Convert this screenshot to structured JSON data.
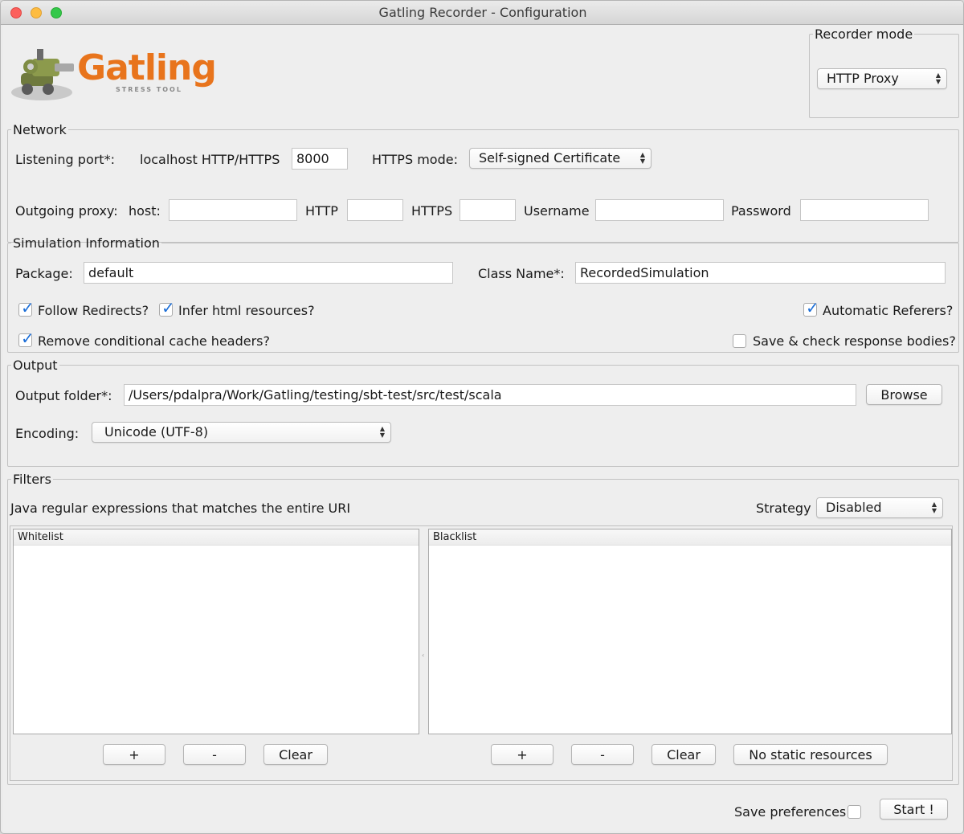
{
  "window": {
    "title": "Gatling Recorder - Configuration"
  },
  "logo": {
    "brand": "Gatling",
    "tagline": "STRESS TOOL"
  },
  "recorder_mode": {
    "legend": "Recorder mode",
    "value": "HTTP Proxy"
  },
  "network": {
    "legend": "Network",
    "listening_port_label": "Listening port*:",
    "localhost_label": "localhost HTTP/HTTPS",
    "port_value": "8000",
    "https_mode_label": "HTTPS mode:",
    "https_mode_value": "Self-signed Certificate",
    "outgoing_proxy_label": "Outgoing proxy:",
    "host_label": "host:",
    "host_value": "",
    "http_label": "HTTP",
    "http_value": "",
    "https_label": "HTTPS",
    "https_value": "",
    "username_label": "Username",
    "username_value": "",
    "password_label": "Password",
    "password_value": ""
  },
  "simulation": {
    "legend": "Simulation Information",
    "package_label": "Package:",
    "package_value": "default",
    "class_label": "Class Name*:",
    "class_value": "RecordedSimulation",
    "follow_redirects": "Follow Redirects?",
    "infer_html": "Infer html resources?",
    "automatic_referers": "Automatic Referers?",
    "remove_cache": "Remove conditional cache headers?",
    "save_bodies": "Save & check response bodies?"
  },
  "output": {
    "legend": "Output",
    "folder_label": "Output folder*:",
    "folder_value": "/Users/pdalpra/Work/Gatling/testing/sbt-test/src/test/scala",
    "browse": "Browse",
    "encoding_label": "Encoding:",
    "encoding_value": "Unicode (UTF-8)"
  },
  "filters": {
    "legend": "Filters",
    "description": "Java regular expressions that matches the entire URI",
    "strategy_label": "Strategy",
    "strategy_value": "Disabled",
    "whitelist_header": "Whitelist",
    "blacklist_header": "Blacklist",
    "add": "+",
    "remove": "-",
    "clear": "Clear",
    "no_static": "No static resources"
  },
  "footer": {
    "save_prefs": "Save preferences",
    "start": "Start !"
  },
  "colors": {
    "accent": "#1d6fd8",
    "logo_orange": "#e8741c"
  }
}
